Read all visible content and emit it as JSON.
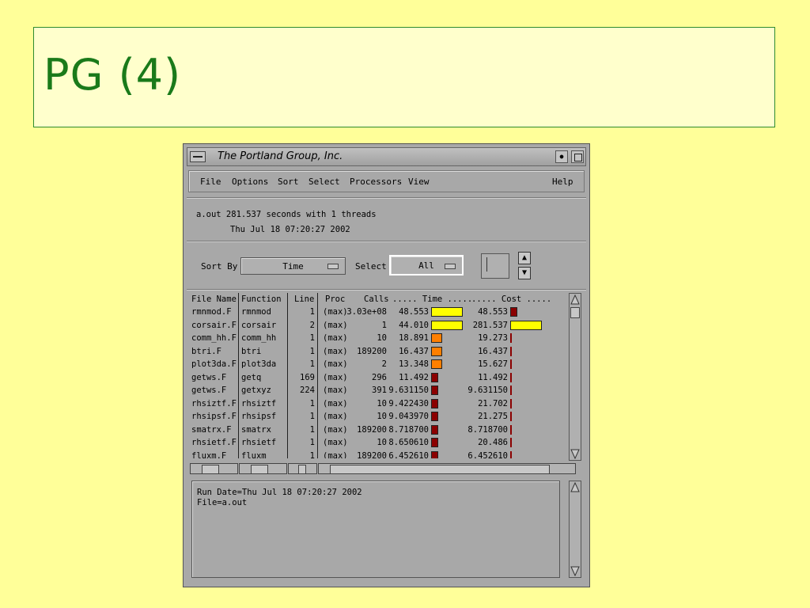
{
  "slide": {
    "title": "PG (4)"
  },
  "window": {
    "title": "The Portland Group, Inc.",
    "icon_names": [
      "window-menu-icon",
      "minimize-icon",
      "maximize-icon"
    ]
  },
  "menu": {
    "file": "File",
    "options": "Options",
    "sort": "Sort",
    "select": "Select",
    "processors": "Processors",
    "view": "View",
    "help": "Help"
  },
  "info": {
    "line1": "a.out  281.537 seconds with 1 threads",
    "line2": "Thu Jul 18 07:20:27 2002"
  },
  "controls": {
    "sort_by_label": "Sort By",
    "sort_value": "Time",
    "select_label": "Select",
    "select_value": "All"
  },
  "table": {
    "headers": {
      "file": "File Name",
      "function": "Function",
      "line": "Line",
      "proc": "Proc",
      "calls": "Calls",
      "time": "..... Time .....",
      "cost": "..... Cost ....."
    },
    "rows": [
      {
        "file": "rmnmod.F",
        "function": "rmnmod",
        "line": "1",
        "proc": "(max)",
        "calls": "3.03e+08",
        "time": "48.553",
        "cost": "48.553",
        "time_bar": "yellow",
        "cost_bar": "dark"
      },
      {
        "file": "corsair.F",
        "function": "corsair",
        "line": "2",
        "proc": "(max)",
        "calls": "1",
        "time": "44.010",
        "cost": "281.537",
        "time_bar": "yellow",
        "cost_bar": "yellow"
      },
      {
        "file": "comm_hh.F",
        "function": "comm_hh",
        "line": "1",
        "proc": "(max)",
        "calls": "10",
        "time": "18.891",
        "cost": "19.273",
        "time_bar": "orange",
        "cost_bar": "thin"
      },
      {
        "file": "btri.F",
        "function": "btri",
        "line": "1",
        "proc": "(max)",
        "calls": "189200",
        "time": "16.437",
        "cost": "16.437",
        "time_bar": "orange",
        "cost_bar": "thin"
      },
      {
        "file": "plot3da.F",
        "function": "plot3da",
        "line": "1",
        "proc": "(max)",
        "calls": "2",
        "time": "13.348",
        "cost": "15.627",
        "time_bar": "orange",
        "cost_bar": "thin"
      },
      {
        "file": "getws.F",
        "function": "getq",
        "line": "169",
        "proc": "(max)",
        "calls": "296",
        "time": "11.492",
        "cost": "11.492",
        "time_bar": "dark",
        "cost_bar": "thin"
      },
      {
        "file": "getws.F",
        "function": "getxyz",
        "line": "224",
        "proc": "(max)",
        "calls": "391",
        "time": "9.631150",
        "cost": "9.631150",
        "time_bar": "dark",
        "cost_bar": "thin"
      },
      {
        "file": "rhsiztf.F",
        "function": "rhsiztf",
        "line": "1",
        "proc": "(max)",
        "calls": "10",
        "time": "9.422430",
        "cost": "21.702",
        "time_bar": "dark",
        "cost_bar": "thin"
      },
      {
        "file": "rhsipsf.F",
        "function": "rhsipsf",
        "line": "1",
        "proc": "(max)",
        "calls": "10",
        "time": "9.043970",
        "cost": "21.275",
        "time_bar": "dark",
        "cost_bar": "thin"
      },
      {
        "file": "smatrx.F",
        "function": "smatrx",
        "line": "1",
        "proc": "(max)",
        "calls": "189200",
        "time": "8.718700",
        "cost": "8.718700",
        "time_bar": "dark",
        "cost_bar": "thin"
      },
      {
        "file": "rhsietf.F",
        "function": "rhsietf",
        "line": "1",
        "proc": "(max)",
        "calls": "10",
        "time": "8.650610",
        "cost": "20.486",
        "time_bar": "dark",
        "cost_bar": "thin"
      },
      {
        "file": "fluxm.F",
        "function": "fluxm",
        "line": "1",
        "proc": "(max)",
        "calls": "189200",
        "time": "6.452610",
        "cost": "6.452610",
        "time_bar": "dark",
        "cost_bar": "thin"
      }
    ]
  },
  "log": {
    "line1": "Run Date=Thu Jul 18 07:20:27 2002",
    "line2": "File=a.out"
  },
  "colors": {
    "slide_bg": "#ffff99",
    "title_box": "#ffffcc",
    "title_text": "#1a7a1a",
    "window_bg": "#a8a8a8",
    "bar_yellow": "#ffff00",
    "bar_orange": "#ff7f00",
    "bar_dark": "#8b0000"
  }
}
